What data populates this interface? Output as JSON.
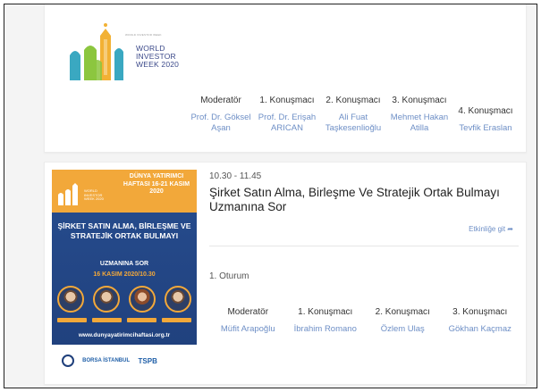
{
  "event_card": {
    "logo": {
      "tiny_text": "WORLD INVESTOR WEEK",
      "lines": [
        "WORLD",
        "INVESTOR",
        "WEEK 2020"
      ],
      "colors": [
        "#f2b134",
        "#3aa8c1",
        "#8cc63f",
        "#6b5fa5"
      ]
    },
    "speakers": [
      {
        "role": "Moderatör",
        "name": "Prof. Dr. Göksel Aşan"
      },
      {
        "role": "1. Konuşmacı",
        "name": "Prof. Dr. Erişah ARICAN"
      },
      {
        "role": "2. Konuşmacı",
        "name": "Ali Fuat Taşkesenlioğlu"
      },
      {
        "role": "3. Konuşmacı",
        "name": "Mehmet Hakan Atilla"
      },
      {
        "role": "4. Konuşmacı",
        "name": "Tevfik Eraslan"
      }
    ]
  },
  "session_card": {
    "poster": {
      "top_title": "DÜNYA YATIRIMCI HAFTASI 16-21 KASIM 2020",
      "mini_logo": [
        "WORLD",
        "INVESTOR",
        "WEEK 2020"
      ],
      "headline": "ŞİRKET SATIN ALMA, BİRLEŞME VE STRATEJİK ORTAK BULMAYI",
      "subheadline": "UZMANINA SOR",
      "date": "16 KASIM 2020/10.30",
      "url": "www.dunyayatirimcihaftasi.org.tr",
      "borsa": "BORSA İSTANBUL",
      "tspb": "TSPB",
      "accent_color": "#f2a83a",
      "background_color": "#274d8f"
    },
    "time": "10.30 - 11.45",
    "title": "Şirket Satın Alma, Birleşme Ve Stratejik Ortak Bulmayı Uzmanına Sor",
    "link_label": "Etkinliğe git",
    "session_label": "1. Oturum",
    "speakers": [
      {
        "role": "Moderatör",
        "name": "Müfit Arapoğlu"
      },
      {
        "role": "1. Konuşmacı",
        "name": "İbrahim Romano"
      },
      {
        "role": "2. Konuşmacı",
        "name": "Özlem Ulaş"
      },
      {
        "role": "3. Konuşmacı",
        "name": "Gökhan Kaçmaz"
      }
    ]
  }
}
